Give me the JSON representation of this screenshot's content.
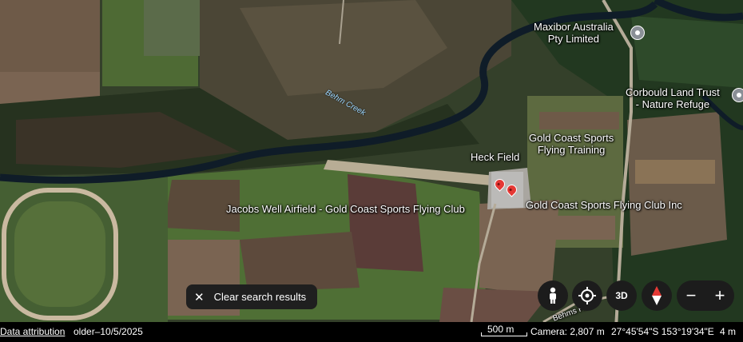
{
  "map": {
    "places": {
      "maxibor": {
        "line1": "Maxibor Australia",
        "line2": "Pty Limited"
      },
      "corbould": {
        "line1": "Corbould Land Trust",
        "line2": "- Nature Refuge"
      },
      "gc_training": {
        "line1": "Gold Coast Sports",
        "line2": "Flying Training"
      },
      "heck_field": "Heck Field",
      "jacobs_well": "Jacobs Well Airfield - Gold Coast Sports Flying Club",
      "gc_club": "Gold Coast Sports Flying Club Inc",
      "creek": "Behm Creek",
      "road": "Behms Rd"
    },
    "colors": {
      "pin": "#e53935",
      "poi_marker": "#8a8f96",
      "water": "#0f1c28"
    }
  },
  "controls": {
    "clear_search_label": "Clear search results",
    "threed_label": "3D",
    "zoom_out_label": "−",
    "zoom_in_label": "+"
  },
  "footer": {
    "data_attribution": "Data attribution",
    "imagery_date": "older–10/5/2025",
    "scale": "500 m",
    "camera": "Camera: 2,807 m",
    "coordinates": "27°45'54\"S 153°19'34\"E",
    "elevation": "4 m"
  }
}
